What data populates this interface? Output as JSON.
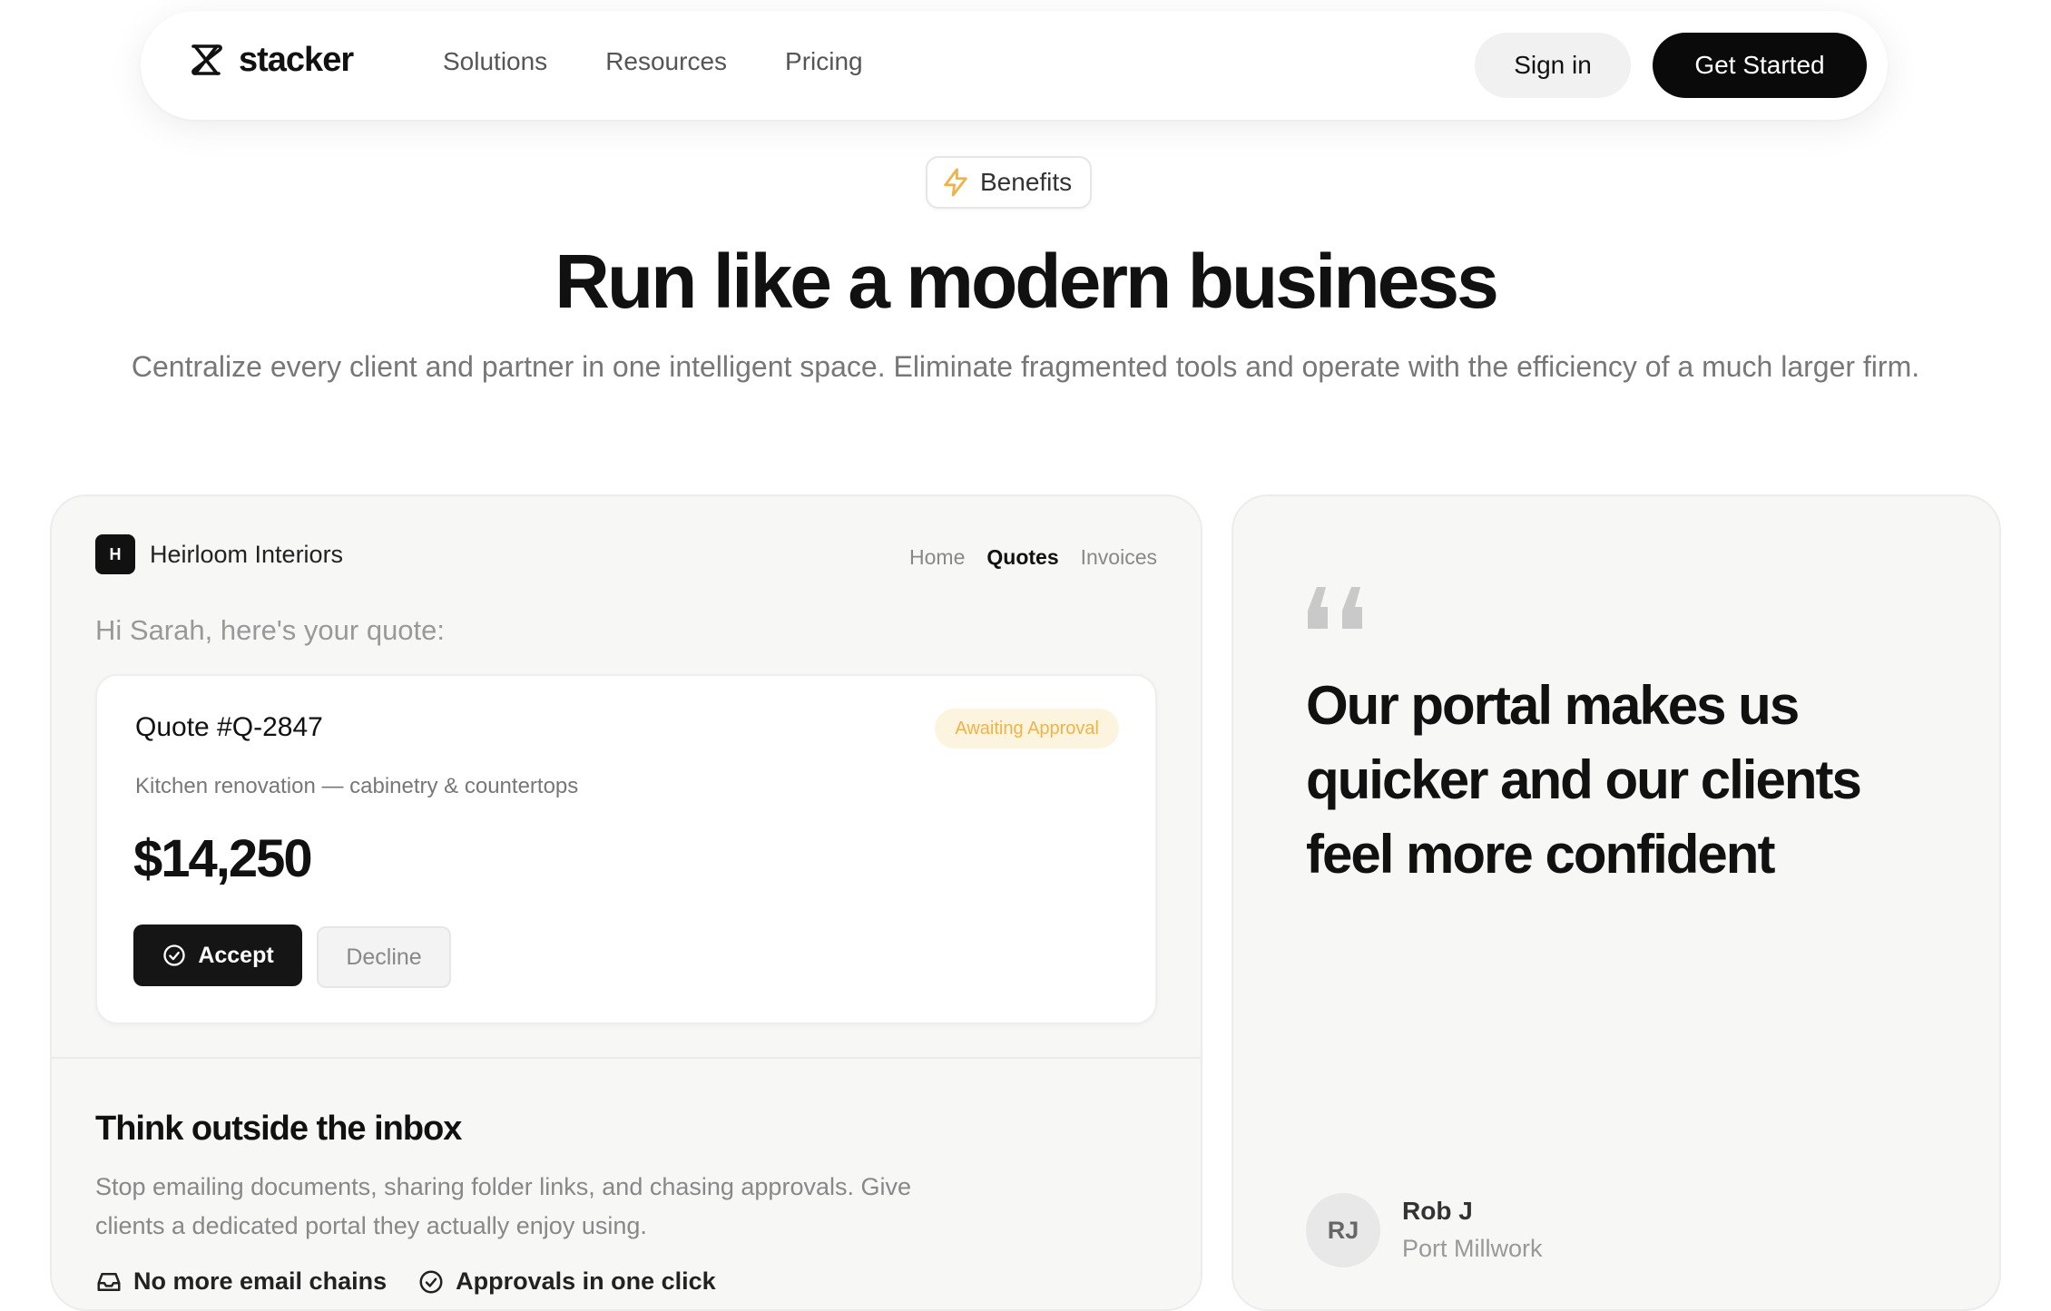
{
  "nav": {
    "logo_text": "stacker",
    "links": [
      "Solutions",
      "Resources",
      "Pricing"
    ],
    "sign_in": "Sign in",
    "get_started": "Get Started"
  },
  "hero": {
    "badge": "Benefits",
    "title": "Run like a modern business",
    "subtitle": "Centralize every client and partner in one intelligent space. Eliminate fragmented tools and operate with the efficiency of a much larger firm."
  },
  "portal": {
    "logo_letter": "H",
    "name": "Heirloom Interiors",
    "nav": [
      "Home",
      "Quotes",
      "Invoices"
    ],
    "active_nav": "Quotes",
    "greeting": "Hi Sarah, here's your quote:",
    "quote": {
      "title": "Quote #Q-2847",
      "status": "Awaiting Approval",
      "description": "Kitchen renovation — cabinetry & countertops",
      "amount": "$14,250",
      "accept": "Accept",
      "decline": "Decline"
    }
  },
  "feature": {
    "title": "Think outside the inbox",
    "description": "Stop emailing documents, sharing folder links, and chasing approvals. Give clients a dedicated portal they actually enjoy using.",
    "items": [
      "No more email chains",
      "Approvals in one click"
    ]
  },
  "testimonial": {
    "quote": "Our portal makes us quicker and our clients feel more confident",
    "initials": "RJ",
    "author": "Rob J",
    "company": "Port Millwork"
  },
  "colors": {
    "status_bg": "#fdf4df",
    "status_text": "#f0b34c",
    "accent_badge_icon": "#f0b34c"
  }
}
